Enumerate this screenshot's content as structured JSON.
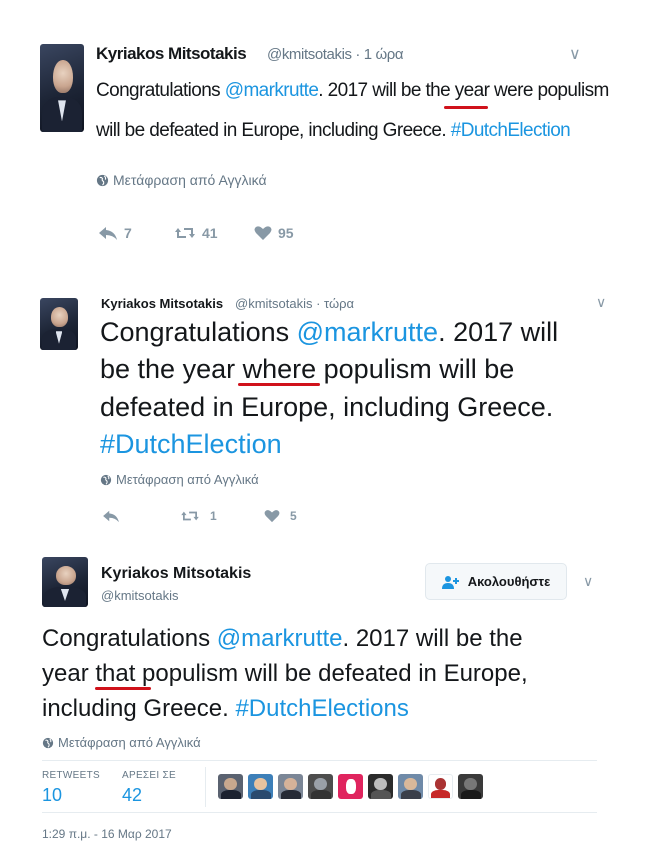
{
  "tweet1": {
    "name": "Kyriakos Mitsotakis",
    "handle": "@kmitsotakis · 1 ώρα",
    "text_pre": "Congratulations ",
    "mention": "@markrutte",
    "text_mid": ". 2017 will be the year ",
    "underlined": "were",
    "text_post1": " populism",
    "line2_text": "will be defeated in Europe, including Greece. ",
    "hashtag": "#DutchElection",
    "translate": "Μετάφραση από Αγγλικά",
    "replies": "7",
    "retweets": "41",
    "likes": "95"
  },
  "tweet2": {
    "name": "Kyriakos Mitsotakis",
    "handle": "@kmitsotakis · τώρα",
    "l1_pre": "Congratulations ",
    "mention": "@markrutte",
    "l1_post": ". 2017 will",
    "l2_pre": "be the year ",
    "underlined": "where",
    "l2_post": " populism will be",
    "line3": "defeated in Europe, including Greece.",
    "hashtag": "#DutchElection",
    "translate": "Μετάφραση από Αγγλικά",
    "retweets": "1",
    "likes": "5"
  },
  "tweet3": {
    "name": "Kyriakos Mitsotakis",
    "handle": "@kmitsotakis",
    "follow_label": "Ακολουθήστε",
    "l1_pre": "Congratulations ",
    "mention": "@markrutte",
    "l1_post": ". 2017 will be the",
    "l2_pre": "year ",
    "underlined": "that",
    "l2_post": " populism will be defeated in Europe,",
    "l3_pre": "including Greece. ",
    "hashtag": "#DutchElections",
    "translate": "Μετάφραση από Αγγλικά",
    "retweets_label": "RETWEETS",
    "retweets": "10",
    "likes_label": "ΑΡΕΣΕΙ ΣΕ",
    "likes": "42",
    "timestamp": "1:29 π.μ. - 16 Μαρ 2017"
  },
  "colors": {
    "link": "#1b95e0",
    "underline": "#d0121b",
    "muted": "#657786",
    "icon": "#8899a6"
  }
}
